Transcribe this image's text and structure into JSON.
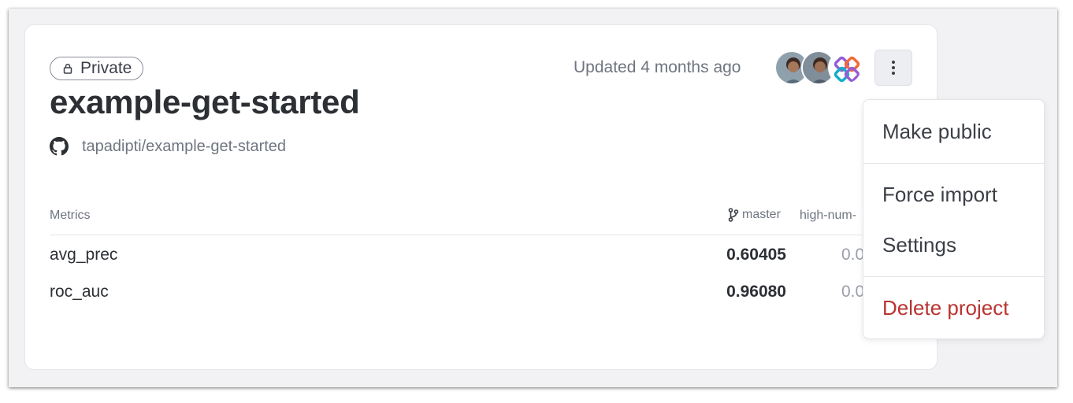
{
  "project": {
    "visibility": "Private",
    "name": "example-get-started",
    "repo": "tapadipti/example-get-started",
    "updated": "Updated 4 months ago"
  },
  "metrics": {
    "header": "Metrics",
    "columns": [
      "master",
      "high-num-"
    ],
    "rows": [
      {
        "name": "avg_prec",
        "master": "0.60405",
        "other": "0.0"
      },
      {
        "name": "roc_auc",
        "master": "0.96080",
        "other": "0.0"
      }
    ]
  },
  "menu": {
    "items": [
      "Make public",
      "Force import",
      "Settings",
      "Delete project"
    ]
  },
  "colors": {
    "danger": "#b8342f",
    "text": "#2c2f34",
    "muted": "#6f7580"
  },
  "icons": [
    "lock-icon",
    "github-icon",
    "kebab-menu-icon",
    "git-branch-icon"
  ]
}
